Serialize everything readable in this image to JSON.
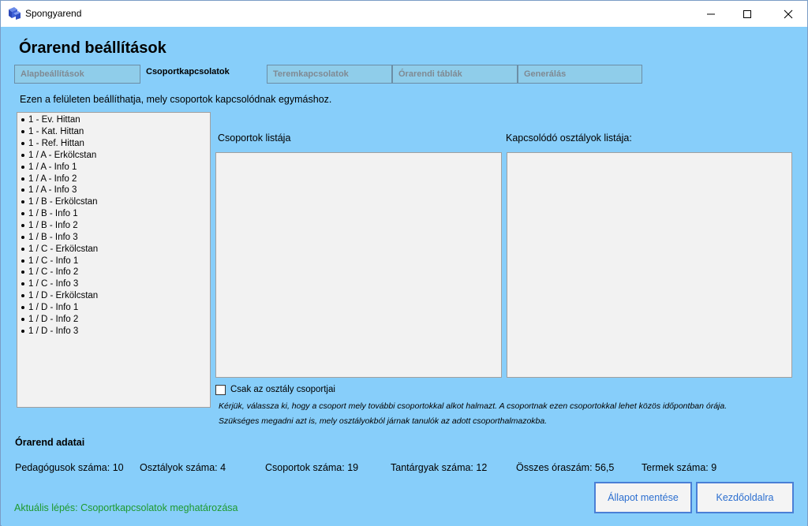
{
  "window": {
    "title": "Spongyarend",
    "controls": {
      "minimize": "minimize-icon",
      "maximize": "maximize-icon",
      "close": "close-icon"
    }
  },
  "page": {
    "title": "Órarend beállítások",
    "description": "Ezen a felületen beállíthatja, mely csoportok kapcsolódnak egymáshoz."
  },
  "tabs": [
    {
      "label": "Alapbeállítások",
      "active": false
    },
    {
      "label": "Csoportkapcsolatok",
      "active": true
    },
    {
      "label": "Teremkapcsolatok",
      "active": false
    },
    {
      "label": "Órarendi táblák",
      "active": false
    },
    {
      "label": "Generálás",
      "active": false
    }
  ],
  "group_list": [
    "1 - Ev. Hittan",
    "1 - Kat. Hittan",
    "1 - Ref. Hittan",
    "1 / A - Erkölcstan",
    "1 / A - Info 1",
    "1 / A - Info 2",
    "1 / A - Info 3",
    "1 / B - Erkölcstan",
    "1 / B - Info 1",
    "1 / B - Info 2",
    "1 / B - Info 3",
    "1 / C - Erkölcstan",
    "1 / C - Info 1",
    "1 / C - Info 2",
    "1 / C - Info 3",
    "1 / D - Erkölcstan",
    "1 / D - Info 1",
    "1 / D - Info 2",
    "1 / D - Info 3"
  ],
  "panels": {
    "groups_label": "Csoportok listája",
    "classes_label": "Kapcsolódó osztályok listája:"
  },
  "checkbox": {
    "label": "Csak az osztály csoportjai",
    "checked": false
  },
  "help_text": {
    "line1": "Kérjük, válassza ki, hogy a csoport mely további csoportokkal alkot halmazt. A csoportnak ezen csoportokkal lehet közös időpontban órája.",
    "line2": "Szükséges megadni azt is, mely osztályokból járnak tanulók az adott csoporthalmazokba."
  },
  "stats": {
    "title": "Órarend adatai",
    "teachers": "Pedagógusok száma: 10",
    "classes": "Osztályok száma: 4",
    "groups": "Csoportok száma: 19",
    "subjects": "Tantárgyak száma: 12",
    "hours": "Összes óraszám: 56,5",
    "rooms": "Termek száma: 9"
  },
  "status": "Aktuális lépés: Csoportkapcsolatok meghatározása",
  "buttons": {
    "save": "Állapot mentése",
    "home": "Kezdőoldalra"
  },
  "colors": {
    "background": "#87cefa",
    "status": "#1e9a2e",
    "button_border": "#4a7fd6",
    "button_text": "#2c6fd0"
  }
}
